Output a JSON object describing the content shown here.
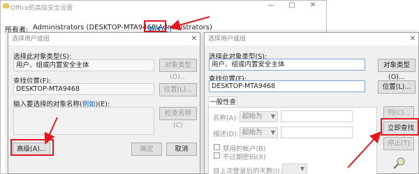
{
  "back_window": {
    "title": "Office的高级安全设置",
    "owner_label": "所有者:",
    "owner_value": "Administrators (DESKTOP-MTA9468\\Administrators)",
    "change_link": "更改(C)",
    "controls": {
      "minimize": "—",
      "maximize": "□",
      "close": "✕"
    }
  },
  "left_dialog": {
    "title": "选择用户或组",
    "close": "✕",
    "object_type_label": "选择此对象类型(S):",
    "object_type_value": "用户、组或内置安全主体",
    "object_type_button": "对象类型(O)...",
    "location_label": "查找位置(F):",
    "location_value": "DESKTOP-MTA9468",
    "location_button": "位置(L)...",
    "enter_names_label": "输入要选择的对象名称(",
    "examples_link": "例如",
    "enter_names_suffix": ")(E):",
    "check_names_button": "检查名称(C)",
    "advanced_button": "高级(A)...",
    "ok_button": "确定",
    "cancel_button": "取消"
  },
  "right_dialog": {
    "title": "选择用户或组",
    "close": "✕",
    "object_type_label": "选择此对象类型(S):",
    "object_type_value": "用户、组或内置安全主体",
    "object_type_button": "对象类型(O)...",
    "location_label": "查找位置(F):",
    "location_value": "DESKTOP-MTA9468",
    "location_button": "位置(L)...",
    "tab_label": "一般性查询",
    "name_label": "名称(A):",
    "name_combo": "起始为",
    "desc_label": "描述(D):",
    "desc_combo": "起始为",
    "columns_button": "列(C)...",
    "find_now_button": "立即查找(N)",
    "stop_button": "停止(T)",
    "disabled_accounts": "禁用的帐户(B)",
    "non_expiring": "不过期密码(X)",
    "days_since_login": "自上次登录后的天数(I):"
  }
}
